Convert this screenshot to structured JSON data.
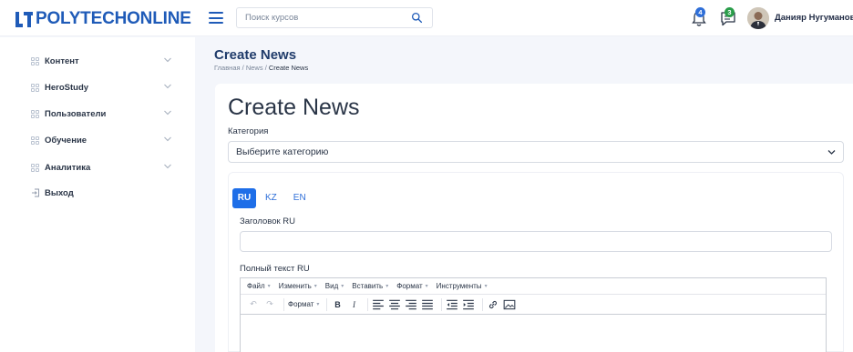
{
  "header": {
    "logo_text": "POLYTECHONLINE",
    "search_placeholder": "Поиск курсов",
    "notifications_count": "4",
    "messages_count": "3",
    "user_name": "Данияр Нугуманов"
  },
  "sidebar": {
    "items": [
      {
        "label": "Контент"
      },
      {
        "label": "HeroStudy"
      },
      {
        "label": "Пользователи"
      },
      {
        "label": "Обучение"
      },
      {
        "label": "Аналитика"
      }
    ],
    "logout_label": "Выход"
  },
  "page": {
    "title": "Create News",
    "breadcrumb": {
      "home": "Главная",
      "section": "News",
      "current": "Create News",
      "separator": "/"
    }
  },
  "form": {
    "heading": "Create News",
    "category_label": "Категория",
    "category_selected": "Выберите категорию",
    "tabs": [
      "RU",
      "KZ",
      "EN"
    ],
    "active_tab": "RU",
    "title_label": "Заголовок RU",
    "title_value": "",
    "body_label": "Полный текст RU"
  },
  "editor": {
    "menus": [
      "Файл",
      "Изменить",
      "Вид",
      "Вставить",
      "Формат",
      "Инструменты"
    ],
    "format_label": "Формат",
    "bold": "B",
    "italic": "I"
  },
  "colors": {
    "brand": "#1f5bb8",
    "tab_active": "#1e6ee8",
    "notification_badge": "#2f6fd8",
    "message_badge": "#2a9d4a"
  }
}
